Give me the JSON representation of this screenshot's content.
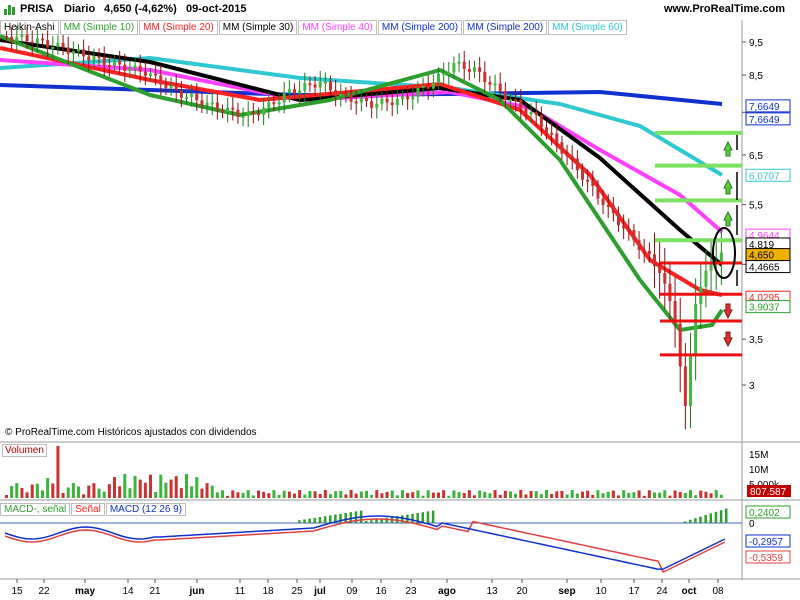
{
  "header": {
    "symbol": "PRISA",
    "period": "Diario",
    "price_change": "4,650 (-4,62%)",
    "date": "09-oct-2015",
    "site": "www.ProRealTime.com"
  },
  "legend": {
    "type": "Heikin-Ashi",
    "items": [
      {
        "label": "MM (Simple 10)",
        "color": "#2e9e2e"
      },
      {
        "label": "MM (Simple 20)",
        "color": "#ff2020"
      },
      {
        "label": "MM (Simple 30)",
        "color": "#000000"
      },
      {
        "label": "MM (Simple 40)",
        "color": "#ff40ff"
      },
      {
        "label": "MM (Simple 200)",
        "color": "#1030d0"
      },
      {
        "label": "MM (Simple 200)",
        "color": "#1030d0"
      },
      {
        "label": "MM (Simple 60)",
        "color": "#30c8d0"
      }
    ]
  },
  "watermark": "© ProRealTime.com Históricos ajustados con dividendos",
  "volume_panel": {
    "label": "Volumen",
    "ticks": [
      "15M",
      "10M",
      "5,000k"
    ],
    "badge": "807.587"
  },
  "macd_panel": {
    "labels": [
      "MACD-, señal",
      "Señal",
      "MACD (12 26 9)"
    ],
    "badges": [
      "0,2402",
      "-0,2957",
      "-0,5359"
    ],
    "zero_tick": "0"
  },
  "chart_data": {
    "type": "candlestick",
    "x_ticks": [
      "15",
      "22",
      "may",
      "14",
      "21",
      "jun",
      "11",
      "18",
      "25",
      "jul",
      "09",
      "16",
      "23",
      "ago",
      "13",
      "20",
      "sep",
      "10",
      "17",
      "24",
      "oct",
      "08"
    ],
    "y_ticks": [
      "9,5",
      "8,5",
      "7,5",
      "6,5",
      "5,5",
      "4,5",
      "3,5",
      "3"
    ],
    "price_badges": [
      {
        "text": "7,6649",
        "color": "#1030d0"
      },
      {
        "text": "7,6649",
        "color": "#1030d0"
      },
      {
        "text": "6,0707",
        "color": "#30c8d0"
      },
      {
        "text": "4,9644",
        "color": "#ff40ff"
      },
      {
        "text": "4,819",
        "color": "#000000"
      },
      {
        "text": "4,650",
        "color": "#000000"
      },
      {
        "text": "4,4665",
        "color": "#000000"
      },
      {
        "text": "4,0295",
        "color": "#ff2020"
      },
      {
        "text": "3,9037",
        "color": "#2e9e2e"
      }
    ],
    "ylim": [
      2.6,
      10.0
    ],
    "log_scale": true,
    "last_close": 4.65,
    "green_levels": [
      7.0,
      6.27,
      5.58,
      4.88
    ],
    "red_levels": [
      4.52,
      4.07,
      3.72,
      3.32
    ]
  }
}
